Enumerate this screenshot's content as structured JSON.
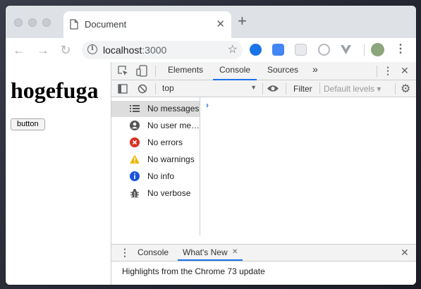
{
  "browser": {
    "tab_title": "Document",
    "url_host": "localhost",
    "url_port": ":3000",
    "accent_color": "#1a73e8"
  },
  "page": {
    "heading": "hogefuga",
    "button_label": "button"
  },
  "devtools": {
    "tabs": [
      "Elements",
      "Console",
      "Sources"
    ],
    "active_tab": "Console",
    "more_tabs_label": "»",
    "context": "top",
    "filter_placeholder": "Filter",
    "levels_label": "Default levels ▾",
    "sidebar": [
      {
        "label": "No messages",
        "icon": "list-icon"
      },
      {
        "label": "No user me…",
        "icon": "user-icon"
      },
      {
        "label": "No errors",
        "icon": "error-icon"
      },
      {
        "label": "No warnings",
        "icon": "warning-icon"
      },
      {
        "label": "No info",
        "icon": "info-icon"
      },
      {
        "label": "No verbose",
        "icon": "bug-icon"
      }
    ],
    "console_prompt": "›",
    "drawer": {
      "tabs": [
        "Console",
        "What's New"
      ],
      "active_tab": "What's New",
      "content": "Highlights from the Chrome 73 update"
    }
  }
}
